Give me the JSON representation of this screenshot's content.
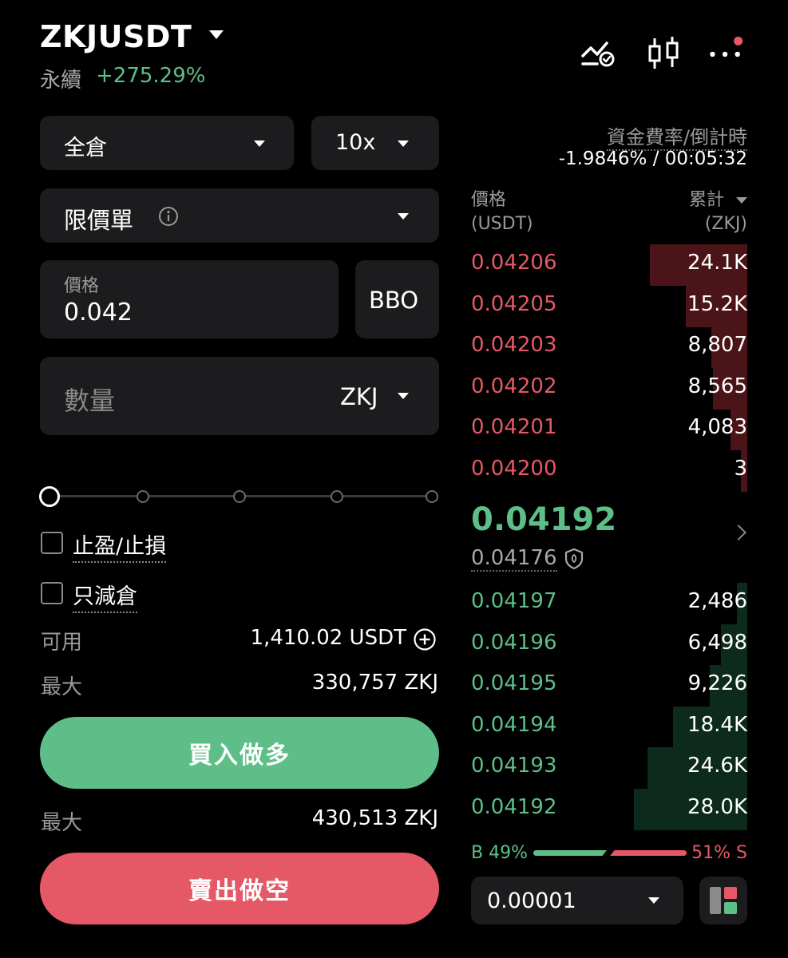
{
  "header": {
    "symbol": "ZKJUSDT",
    "contract_type": "永續",
    "change": "+275.29%",
    "icons": [
      "price-alert-icon",
      "candlestick-chart-icon",
      "more-icon"
    ]
  },
  "order_form": {
    "margin_mode": "全倉",
    "leverage": "10x",
    "order_type": "限價單",
    "price_label": "價格",
    "price_value": "0.042",
    "bbo_label": "BBO",
    "quantity_placeholder": "數量",
    "quantity_unit": "ZKJ",
    "slider_percent": 0,
    "tp_sl_label": "止盈/止損",
    "reduce_only_label": "只減倉",
    "available_label": "可用",
    "available_value": "1,410.02 USDT",
    "max_buy_label": "最大",
    "max_buy_value": "330,757 ZKJ",
    "buy_button": "買入做多",
    "max_sell_label": "最大",
    "max_sell_value": "430,513 ZKJ",
    "sell_button": "賣出做空"
  },
  "orderbook": {
    "funding_label": "資金費率/倒計時",
    "funding_value": "-1.9846% / 00:05:32",
    "price_header": "價格",
    "price_unit": "(USDT)",
    "qty_header": "累計",
    "qty_unit": "(ZKJ)",
    "asks": [
      {
        "price": "0.04206",
        "qty": "24.1K",
        "depth": 24100
      },
      {
        "price": "0.04205",
        "qty": "15.2K",
        "depth": 15200
      },
      {
        "price": "0.04203",
        "qty": "8,807",
        "depth": 8807
      },
      {
        "price": "0.04202",
        "qty": "8,565",
        "depth": 8565
      },
      {
        "price": "0.04201",
        "qty": "4,083",
        "depth": 4083
      },
      {
        "price": "0.04200",
        "qty": "3",
        "depth": 3
      }
    ],
    "last_price": "0.04192",
    "mark_price": "0.04176",
    "bids": [
      {
        "price": "0.04197",
        "qty": "2,486",
        "depth": 2486
      },
      {
        "price": "0.04196",
        "qty": "6,498",
        "depth": 6498
      },
      {
        "price": "0.04195",
        "qty": "9,226",
        "depth": 9226
      },
      {
        "price": "0.04194",
        "qty": "18.4K",
        "depth": 18400
      },
      {
        "price": "0.04193",
        "qty": "24.6K",
        "depth": 24600
      },
      {
        "price": "0.04192",
        "qty": "28.0K",
        "depth": 28000
      }
    ],
    "buy_ratio_label": "B 49%",
    "sell_ratio_label": "51% S",
    "tick_size": "0.00001",
    "colors": {
      "green": "#5dbf87",
      "red": "#e45965"
    }
  }
}
